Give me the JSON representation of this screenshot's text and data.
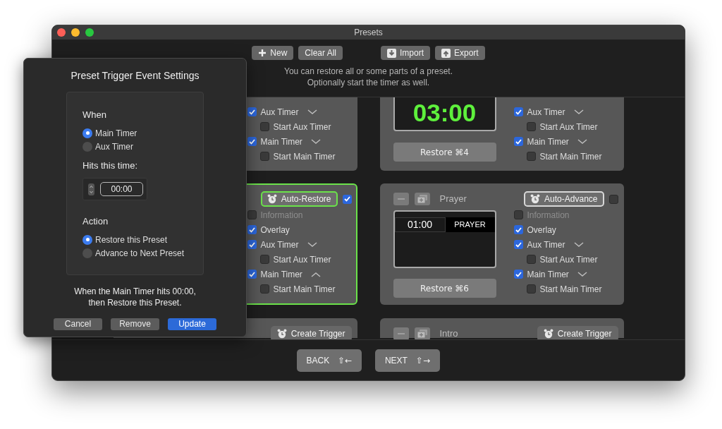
{
  "window": {
    "title": "Presets"
  },
  "toolbar": {
    "buttons": [
      {
        "kind": "new",
        "label": "New"
      },
      {
        "kind": "clear",
        "label": "Clear All"
      },
      {
        "kind": "import",
        "label": "Import"
      },
      {
        "kind": "export",
        "label": "Export"
      }
    ],
    "hint": [
      "You can restore all or some parts of a preset.",
      "Optionally start the timer as well."
    ]
  },
  "preset_rows": [
    {
      "cards": [
        {
          "selected": false,
          "options": [
            {
              "label": "Aux Timer",
              "checked": true,
              "disabled": false,
              "expanded": false,
              "children": [
                {
                  "label": "Start Aux Timer",
                  "checked": false,
                  "disabled": false
                }
              ]
            },
            {
              "label": "Main Timer",
              "checked": true,
              "disabled": false,
              "expanded": false,
              "children": [
                {
                  "label": "Start Main Timer",
                  "checked": false,
                  "disabled": false
                }
              ]
            }
          ]
        },
        {
          "selected": false,
          "display": {
            "kind": "clock",
            "time": "03:00"
          },
          "restore": "Restore ⌘4",
          "options": [
            {
              "label": "Aux Timer",
              "checked": true,
              "disabled": false,
              "expanded": false,
              "children": [
                {
                  "label": "Start Aux Timer",
                  "checked": false,
                  "disabled": false
                }
              ]
            },
            {
              "label": "Main Timer",
              "checked": true,
              "disabled": false,
              "expanded": false,
              "children": [
                {
                  "label": "Start Main Timer",
                  "checked": false,
                  "disabled": false
                }
              ]
            }
          ]
        }
      ]
    },
    {
      "cards": [
        {
          "selected": true,
          "trigger": {
            "label": "Auto-Restore",
            "set": true,
            "editing": true
          },
          "enabled": true,
          "options": [
            {
              "label": "Information",
              "checked": false,
              "disabled": true
            },
            {
              "label": "Overlay",
              "checked": true,
              "disabled": false
            },
            {
              "label": "Aux Timer",
              "checked": true,
              "disabled": false,
              "expanded": false,
              "children": [
                {
                  "label": "Start Aux Timer",
                  "checked": false,
                  "disabled": false
                }
              ]
            },
            {
              "label": "Main Timer",
              "checked": true,
              "disabled": false,
              "expanded": true,
              "children": [
                {
                  "label": "Start Main Timer",
                  "checked": false,
                  "disabled": false
                }
              ]
            }
          ]
        },
        {
          "selected": false,
          "name": "Prayer",
          "trigger": {
            "label": "Auto-Advance",
            "set": true,
            "editing": false
          },
          "enabled": false,
          "display": {
            "kind": "title",
            "time": "01:00",
            "title": "PRAYER"
          },
          "restore": "Restore ⌘6",
          "options": [
            {
              "label": "Information",
              "checked": false,
              "disabled": true
            },
            {
              "label": "Overlay",
              "checked": true,
              "disabled": false
            },
            {
              "label": "Aux Timer",
              "checked": true,
              "disabled": false,
              "expanded": false,
              "children": [
                {
                  "label": "Start Aux Timer",
                  "checked": false,
                  "disabled": false
                }
              ]
            },
            {
              "label": "Main Timer",
              "checked": true,
              "disabled": false,
              "expanded": false,
              "children": [
                {
                  "label": "Start Main Timer",
                  "checked": false,
                  "disabled": false
                }
              ]
            }
          ]
        }
      ]
    },
    {
      "cards": [
        {
          "selected": false,
          "trigger": {
            "label": "Create Trigger",
            "set": false,
            "editing": false
          }
        },
        {
          "selected": false,
          "name": "Intro",
          "trigger": {
            "label": "Create Trigger",
            "set": false,
            "editing": false
          }
        }
      ]
    }
  ],
  "navigation": [
    {
      "label": "BACK",
      "shortcut": "⇧←"
    },
    {
      "label": "NEXT",
      "shortcut": "⇧→"
    }
  ],
  "trigger_popover": {
    "title": "Preset Trigger Event Settings",
    "when": {
      "label": "When",
      "options": [
        {
          "label": "Main Timer",
          "selected": true
        },
        {
          "label": "Aux Timer",
          "selected": false
        }
      ]
    },
    "time": {
      "label": "Hits this time:",
      "value": "00:00"
    },
    "action": {
      "label": "Action",
      "options": [
        {
          "label": "Restore this Preset",
          "selected": true
        },
        {
          "label": "Advance to Next Preset",
          "selected": false
        }
      ]
    },
    "summary": [
      "When the Main Timer hits 00:00,",
      "then Restore this Preset."
    ],
    "buttons": [
      {
        "label": "Cancel",
        "primary": false
      },
      {
        "label": "Remove",
        "primary": false
      },
      {
        "label": "Update",
        "primary": true
      }
    ]
  }
}
